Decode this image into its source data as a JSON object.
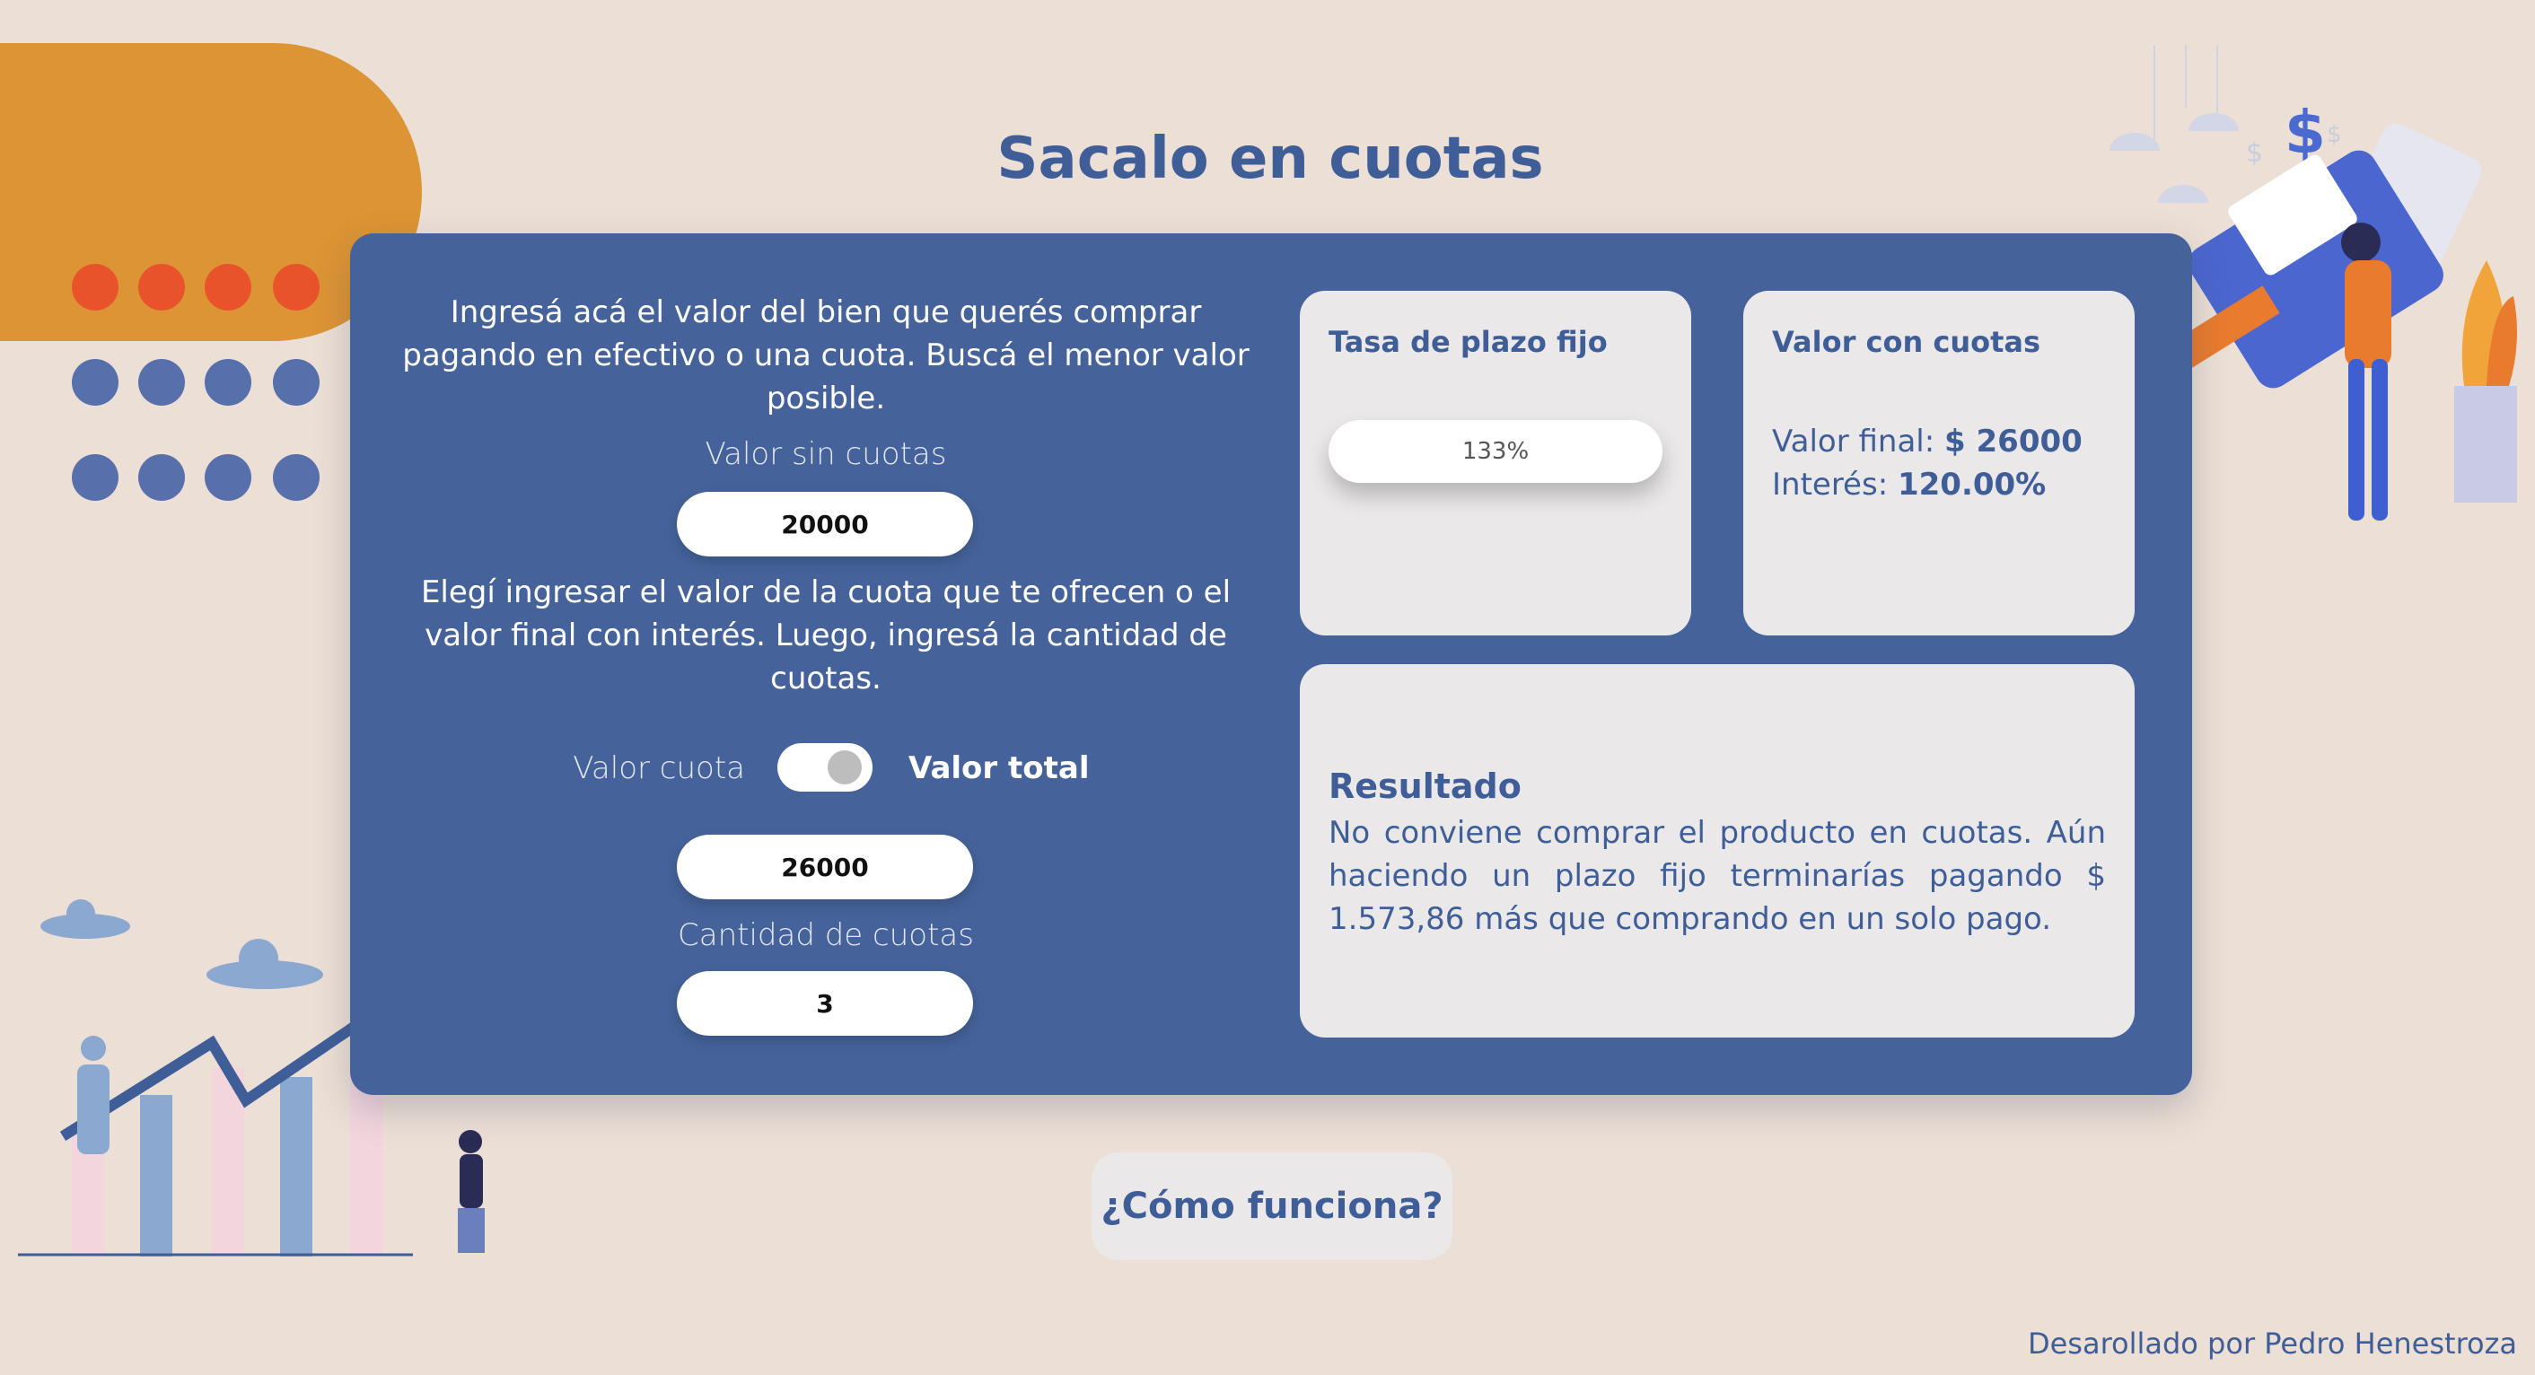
{
  "title": "Sacalo en cuotas",
  "form": {
    "intro_1": "Ingresá acá el valor del bien que querés comprar pagando en efectivo o una cuota. Buscá el menor valor posible.",
    "price_label": "Valor sin cuotas",
    "price_value": "20000",
    "intro_2": "Elegí ingresar el valor de la cuota que te ofrecen o el valor final con interés. Luego, ingresá la cantidad de cuotas.",
    "toggle": {
      "left_label": "Valor cuota",
      "right_label": "Valor total",
      "state": "Valor total"
    },
    "total_value": "26000",
    "installments_label": "Cantidad de cuotas",
    "installments_value": "3"
  },
  "rate_card": {
    "title": "Tasa de plazo fijo",
    "value": "133%"
  },
  "value_card": {
    "title": "Valor con cuotas",
    "final_label": "Valor final:",
    "final_value": "$ 26000",
    "interest_label": "Interés:",
    "interest_value": "120.00%"
  },
  "result_card": {
    "title": "Resultado",
    "text": "No conviene comprar el producto en cuotas. Aún haciendo un plazo fijo terminarías pagando $ 1.573,86 más que comprando en un solo pago."
  },
  "how_button": "¿Cómo funciona?",
  "footer": "Desarollado por Pedro Henestroza",
  "colors": {
    "primary": "#45639a",
    "text": "#3f5e98",
    "background": "#ecdfd6",
    "accent": "#dc9434",
    "red_dot": "#e9532b"
  },
  "icons": [
    "money-dollar-icon",
    "pos-terminal-illustration",
    "growth-chart-illustration",
    "cloud-icon"
  ]
}
